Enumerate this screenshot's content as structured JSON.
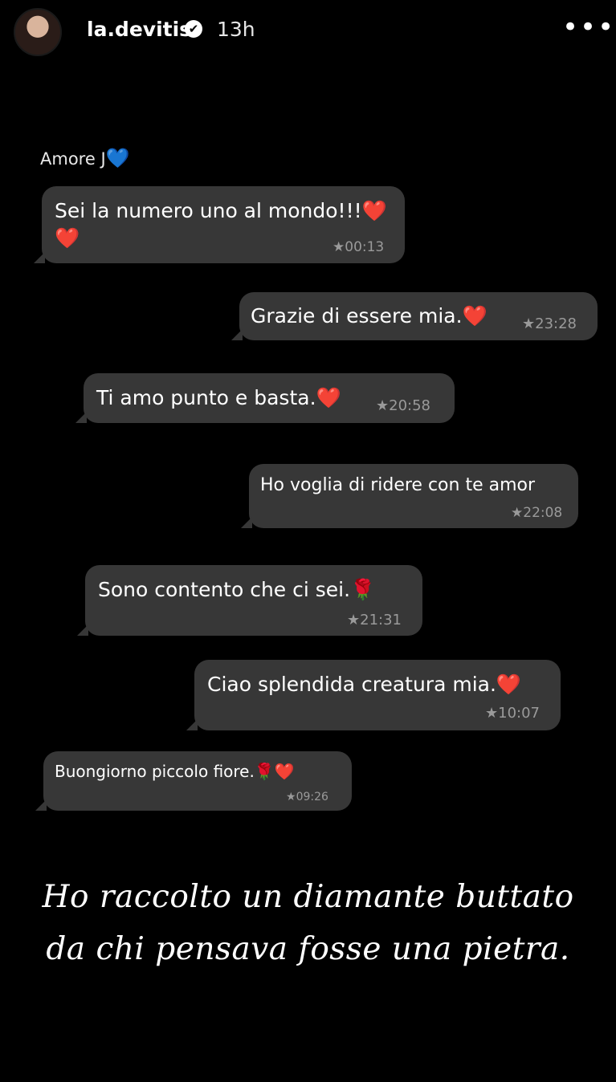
{
  "header": {
    "username": "la.devitis",
    "verified_icon": "✔",
    "time_ago": "13h",
    "more_icon": "•••"
  },
  "chat": {
    "contact_name": "Amore J",
    "contact_heart": "💙",
    "messages": [
      {
        "text": "Sei la numero uno al mondo!!!",
        "emoji": "❤️",
        "emoji2": "❤️",
        "time": "00:13",
        "direction": "in"
      },
      {
        "text": "Grazie di essere mia.",
        "emoji": "❤️",
        "time": "23:28",
        "direction": "in"
      },
      {
        "text": "Ti amo punto e basta.",
        "emoji": "❤️",
        "time": "20:58",
        "direction": "in"
      },
      {
        "text": "Ho voglia di ridere con te amor",
        "time": "22:08",
        "direction": "in"
      },
      {
        "text": "Sono contento che ci sei.",
        "emoji": "🌹",
        "time": "21:31",
        "direction": "in"
      },
      {
        "text": "Ciao splendida creatura mia.",
        "emoji": "❤️",
        "time": "10:07",
        "direction": "in"
      },
      {
        "text": "Buongiorno piccolo fiore.",
        "emoji": "🌹",
        "emoji2": "❤️",
        "time": "09:26",
        "direction": "in"
      }
    ],
    "star": "★"
  },
  "caption": {
    "line1": "Ho raccolto un diamante buttato",
    "line2": "da chi pensava fosse una pietra."
  }
}
